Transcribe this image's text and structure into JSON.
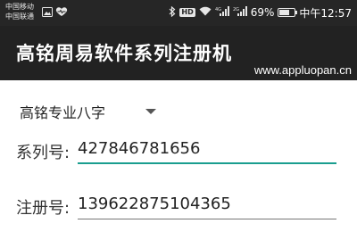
{
  "status_bar": {
    "carrier_line1": "中国移动",
    "carrier_line2": "中国联通",
    "signal_label_1": "4G",
    "signal_label_2": "2G",
    "battery_percent": "69%",
    "battery_level": 0.69,
    "clock": "中午12:57"
  },
  "app_bar": {
    "title": "高铭周易软件系列注册机",
    "watermark": "www.appluopan.cn"
  },
  "form": {
    "product_spinner": {
      "selected": "高铭专业八字"
    },
    "serial": {
      "label": "系列号:",
      "value": "427846781656"
    },
    "registration": {
      "label": "注册号:",
      "value": "139622875104365"
    }
  },
  "colors": {
    "accent": "#1a9e8f",
    "app_bar": "#222222",
    "status_bar": "#262626"
  }
}
